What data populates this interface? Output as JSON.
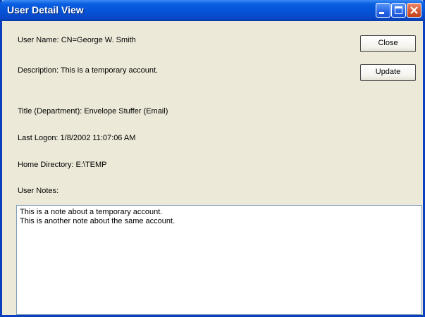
{
  "window": {
    "title": "User Detail View"
  },
  "fields": {
    "user_name": "User Name: CN=George W. Smith",
    "description": "Description: This is a temporary account.",
    "title_department": "Title (Department): Envelope Stuffer (Email)",
    "last_logon": "Last Logon: 1/8/2002 11:07:06 AM",
    "home_directory": "Home Directory: E:\\TEMP",
    "user_notes_label": "User Notes:"
  },
  "buttons": {
    "close": "Close",
    "update": "Update"
  },
  "notes": {
    "lines": [
      "This is a note about a temporary account.",
      "This is another note about the same account."
    ]
  },
  "colors": {
    "titlebar": "#0553d8",
    "window_bg": "#ece9d8",
    "close_button": "#d65a35"
  },
  "icons": {
    "minimize": "minimize-icon",
    "maximize": "maximize-icon",
    "close": "close-icon"
  }
}
